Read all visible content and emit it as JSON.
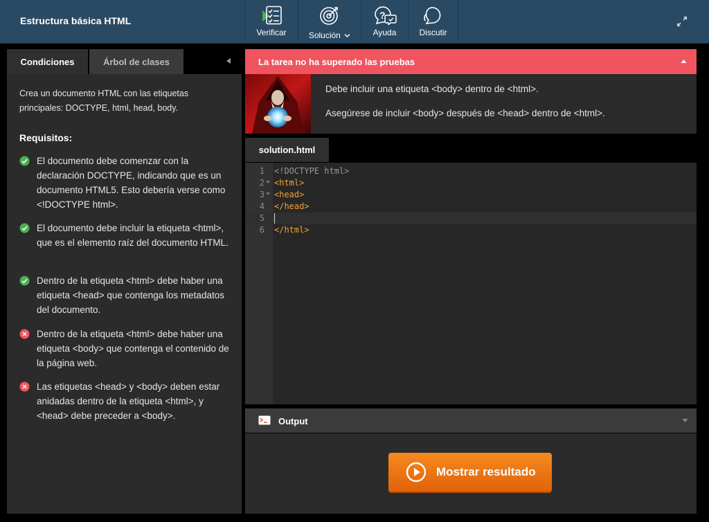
{
  "header": {
    "title": "Estructura básica HTML",
    "toolbar": [
      {
        "icon": "checklist-play-icon",
        "label": "Verificar"
      },
      {
        "icon": "target-icon",
        "label": "Solución",
        "has_dropdown": true
      },
      {
        "icon": "question-chat-icon",
        "label": "Ayuda"
      },
      {
        "icon": "chat-bubble-icon",
        "label": "Discutir"
      }
    ],
    "expand_icon": "expand-arrows-icon"
  },
  "left_tabs": [
    "Condiciones",
    "Árbol de clases"
  ],
  "conditions": {
    "description": "Crea un documento HTML con las etiquetas principales: DOCTYPE, html, head, body.",
    "requirements_title": "Requisitos:",
    "requirements": [
      {
        "status": "pass",
        "text": "El documento debe comenzar con la declaración DOCTYPE, indicando que es un documento HTML5. Esto debería verse como <!DOCTYPE html>."
      },
      {
        "status": "pass",
        "text": "El documento debe incluir la etiqueta <html>, que es el elemento raíz del documento HTML."
      },
      {
        "status": "pass",
        "text": "Dentro de la etiqueta <html> debe haber una etiqueta <head> que contenga los metadatos del documento."
      },
      {
        "status": "fail",
        "text": "Dentro de la etiqueta <html> debe haber una etiqueta <body> que contenga el contenido de la página web."
      },
      {
        "status": "fail",
        "text": "Las etiquetas <head> y <body> deben estar anidadas dentro de la etiqueta <html>, y <head> debe preceder a <body>."
      }
    ]
  },
  "failure": {
    "title": "La tarea no ha superado las pruebas",
    "messages": [
      "Debe incluir una etiqueta <body> dentro de <html>.",
      "Asegúrese de incluir <body> después de <head> dentro de <html>."
    ]
  },
  "editor": {
    "filename": "solution.html",
    "lines": [
      {
        "n": "1",
        "text": "<!DOCTYPE html>",
        "kind": "doctype",
        "fold": false
      },
      {
        "n": "2",
        "text": "<html>",
        "kind": "tag",
        "fold": true
      },
      {
        "n": "3",
        "text": "<head>",
        "kind": "tag",
        "fold": true
      },
      {
        "n": "4",
        "text": "</head>",
        "kind": "tag",
        "fold": false
      },
      {
        "n": "5",
        "text": "",
        "kind": "tag",
        "fold": false,
        "active": true
      },
      {
        "n": "6",
        "text": "</html>",
        "kind": "tag",
        "fold": false
      }
    ]
  },
  "output": {
    "title": "Output",
    "button_label": "Mostrar resultado"
  },
  "colors": {
    "header_bg": "#2a4a63",
    "fail": "#f0555f",
    "pass": "#4caf50",
    "accent_orange": "#f0771a",
    "tag": "#f0a235"
  }
}
